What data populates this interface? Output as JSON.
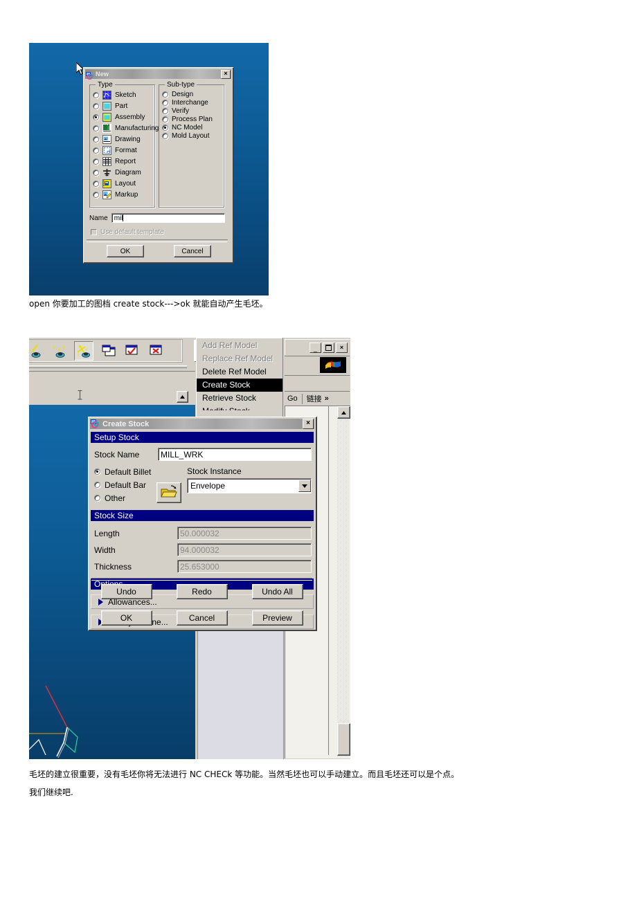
{
  "doc": {
    "caption1": "open 你要加工的图档  create stock--->ok  就能自动产生毛坯。",
    "caption2_line1": "毛坯的建立很重要，没有毛坯你将无法进行 NC CHECk 等功能。当然毛坯也可以手动建立。而且毛坯还可以是个点。",
    "caption2_line2": "我们继续吧."
  },
  "new_dialog": {
    "title": "New",
    "close_label": "×",
    "type_group_label": "Type",
    "subtype_group_label": "Sub-type",
    "types": [
      {
        "label": "Sketch",
        "selected": false,
        "icon": "sketch-icon"
      },
      {
        "label": "Part",
        "selected": false,
        "icon": "part-icon"
      },
      {
        "label": "Assembly",
        "selected": true,
        "icon": "assembly-icon"
      },
      {
        "label": "Manufacturing",
        "selected": false,
        "icon": "manufacturing-icon"
      },
      {
        "label": "Drawing",
        "selected": false,
        "icon": "drawing-icon"
      },
      {
        "label": "Format",
        "selected": false,
        "icon": "format-icon"
      },
      {
        "label": "Report",
        "selected": false,
        "icon": "report-icon"
      },
      {
        "label": "Diagram",
        "selected": false,
        "icon": "diagram-icon"
      },
      {
        "label": "Layout",
        "selected": false,
        "icon": "layout-icon"
      },
      {
        "label": "Markup",
        "selected": false,
        "icon": "markup-icon"
      }
    ],
    "subtypes": [
      {
        "label": "Design",
        "selected": false
      },
      {
        "label": "Interchange",
        "selected": false
      },
      {
        "label": "Verify",
        "selected": false
      },
      {
        "label": "Process Plan",
        "selected": false
      },
      {
        "label": "NC Model",
        "selected": true
      },
      {
        "label": "Mold Layout",
        "selected": false
      }
    ],
    "name_label": "Name",
    "name_value": "mil",
    "use_default_template_label": "Use default template",
    "use_default_template_checked": false,
    "ok_label": "OK",
    "cancel_label": "Cancel"
  },
  "app_window": {
    "menu": {
      "items": [
        {
          "label": "Add Ref Model",
          "state": "disabled"
        },
        {
          "label": "Replace Ref Model",
          "state": "disabled"
        },
        {
          "label": "Delete Ref Model",
          "state": "normal"
        },
        {
          "label": "Create Stock",
          "state": "highlighted"
        },
        {
          "label": "Retrieve Stock",
          "state": "normal"
        },
        {
          "label": "Modify Stock",
          "state": "clipped"
        }
      ]
    },
    "toolbar": {
      "buttons": [
        {
          "name": "csys-single-icon",
          "selected": false
        },
        {
          "name": "csys-xx-icon",
          "selected": false
        },
        {
          "name": "csys-xyz-icon",
          "selected": true
        },
        {
          "name": "new-window-icon",
          "selected": false
        },
        {
          "name": "activate-window-icon",
          "selected": false
        },
        {
          "name": "close-window-icon",
          "selected": false
        },
        {
          "name": "info-ellipse-icon",
          "selected": false
        }
      ]
    },
    "browser": {
      "minimize_label": "_",
      "maximize_label": "□",
      "close_label": "×",
      "go_label": "Go",
      "links_label": "链接",
      "links_overflow_label": "»"
    }
  },
  "create_stock": {
    "title": "Create Stock",
    "close_label": "×",
    "setup_section_label": "Setup Stock",
    "stock_name_label": "Stock Name",
    "stock_name_value": "MILL_WRK",
    "billet_options": [
      {
        "label": "Default Billet",
        "selected": true
      },
      {
        "label": "Default Bar",
        "selected": false
      },
      {
        "label": "Other",
        "selected": false
      }
    ],
    "open_button_name": "open-folder-icon",
    "stock_instance_label": "Stock Instance",
    "stock_instance_value": "Envelope",
    "stock_size_section_label": "Stock Size",
    "size_fields": [
      {
        "label": "Length",
        "value": "50.000032"
      },
      {
        "label": "Width",
        "value": "94.000032"
      },
      {
        "label": "Thickness",
        "value": "25.653000"
      }
    ],
    "options_section_label": "Options",
    "option_rows": [
      {
        "label": "Allowances..."
      },
      {
        "label": "Modify Outline..."
      }
    ],
    "buttons_row1": [
      {
        "label": "Undo"
      },
      {
        "label": "Redo"
      },
      {
        "label": "Undo All"
      }
    ],
    "buttons_row2": [
      {
        "label": "OK"
      },
      {
        "label": "Cancel"
      },
      {
        "label": "Preview"
      }
    ]
  },
  "colors": {
    "desktop_blue": "#0d5b95",
    "dialog_face": "#d4d0c8",
    "section_header": "#000080",
    "highlight": "#000000",
    "disabled_text": "#808080"
  }
}
